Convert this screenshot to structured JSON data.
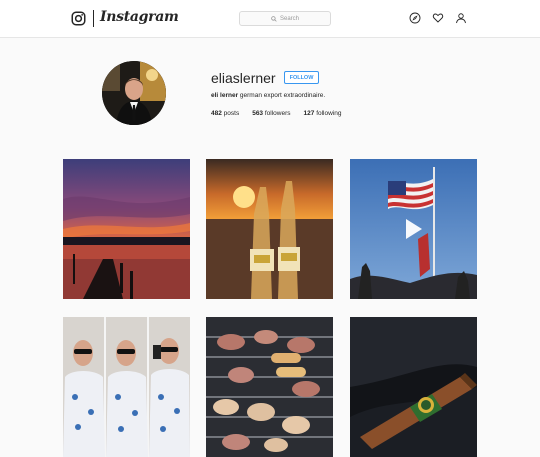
{
  "header": {
    "brand": "Instagram",
    "search_placeholder": "Search",
    "icons": [
      "instagram-logo-icon",
      "search-icon",
      "explore-compass-icon",
      "activity-heart-icon",
      "profile-person-icon"
    ]
  },
  "profile": {
    "username": "eliaslerner",
    "follow_label": "FOLLOW",
    "full_name": "eli lerner",
    "bio_text": " german export extraordinaire.",
    "posts_count": "482",
    "posts_label": " posts",
    "followers_count": "563",
    "followers_label": " followers",
    "following_count": "127",
    "following_label": " following"
  },
  "posts": [
    {
      "name": "post-sunset-dock"
    },
    {
      "name": "post-corona-beach"
    },
    {
      "name": "post-flag-video",
      "icons": [
        "play-icon"
      ]
    },
    {
      "name": "post-selfie-mirror"
    },
    {
      "name": "post-grill"
    },
    {
      "name": "post-cigar"
    }
  ],
  "colors": {
    "accent": "#3897f0",
    "text": "#262626",
    "background": "#fafafa"
  }
}
